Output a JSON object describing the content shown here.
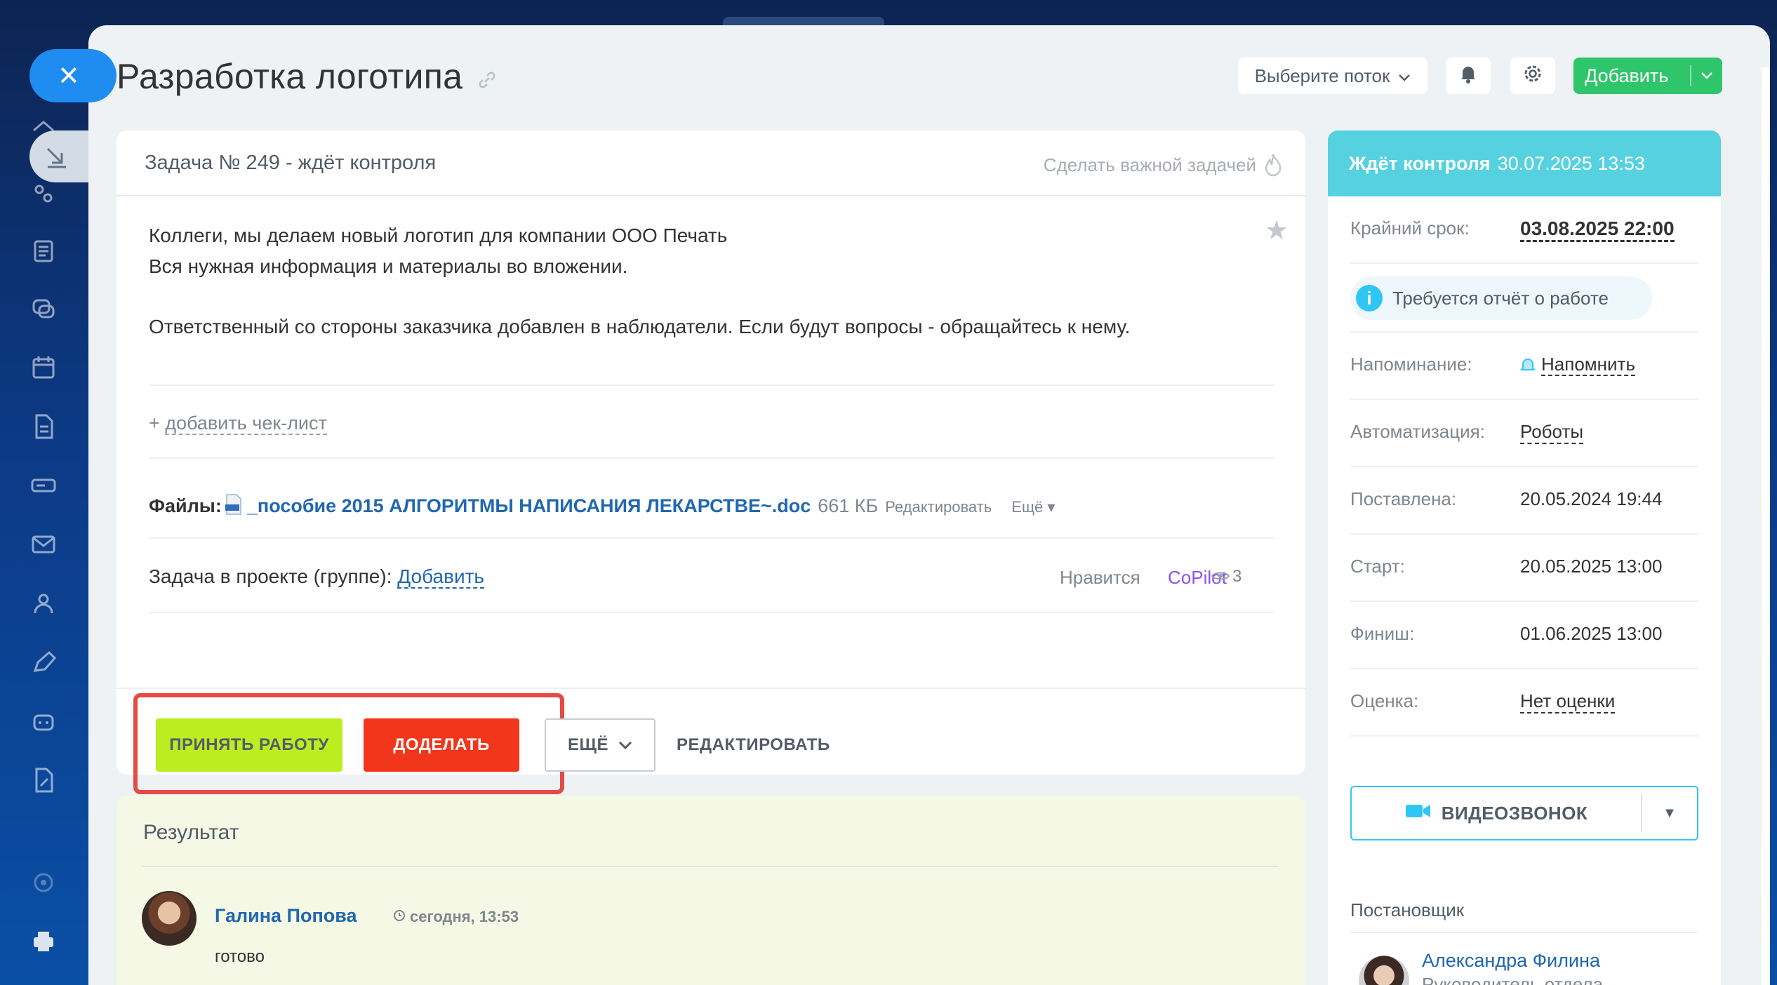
{
  "title": "Разработка логотипа",
  "header": {
    "stream_select": "Выберите поток",
    "add_label": "Добавить"
  },
  "task": {
    "heading": "Задача № 249 - ждёт контроля",
    "make_important": "Сделать важной задачей",
    "description": [
      "Коллеги, мы делаем новый логотип для компании ООО Печать",
      "Вся нужная информация и материалы во вложении.",
      "Ответственный со стороны заказчика добавлен в наблюдатели. Если будут вопросы - обращайтесь к нему."
    ],
    "checklist_plus": "+",
    "checklist_link": "добавить чек-лист",
    "files_label": "Файлы:",
    "file_name": "_пособие 2015 АЛГОРИТМЫ НАПИСАНИЯ ЛЕКАРСТВЕ~.doc",
    "file_size": "661 КБ",
    "file_edit": "Редактировать",
    "file_more": "Ещё",
    "project_label": "Задача в проекте (группе):",
    "project_add": "Добавить",
    "like": "Нравится",
    "copilot": "CoPilot",
    "views": "3"
  },
  "actions": {
    "accept": "ПРИНЯТЬ РАБОТУ",
    "redo": "ДОДЕЛАТЬ",
    "more": "ЕЩЁ",
    "edit": "РЕДАКТИРОВАТЬ"
  },
  "result": {
    "title": "Результат",
    "author": "Галина Попова",
    "time": "сегодня, 13:53",
    "text": "готово"
  },
  "sidebar": {
    "status_label": "Ждёт контроля",
    "status_date": "30.07.2025 13:53",
    "deadline_label": "Крайний срок:",
    "deadline_value": "03.08.2025 22:00",
    "report_required": "Требуется отчёт о работе",
    "reminder_label": "Напоминание:",
    "reminder_value": "Напомнить",
    "automation_label": "Автоматизация:",
    "automation_value": "Роботы",
    "created_label": "Поставлена:",
    "created_value": "20.05.2024 19:44",
    "start_label": "Старт:",
    "start_value": "20.05.2025 13:00",
    "finish_label": "Финиш:",
    "finish_value": "01.06.2025 13:00",
    "rating_label": "Оценка:",
    "rating_value": "Нет оценки",
    "video_call": "ВИДЕОЗВОНОК",
    "creator_label": "Постановщик",
    "creator_name": "Александра Филина",
    "creator_role": "Руководитель отдела маркетинга"
  },
  "colors": {
    "accept_button": "#bbed21",
    "redo_button": "#f1361b",
    "status_bar": "#56d1e0",
    "add_button": "#2fc66b",
    "highlight": "#e44b45"
  }
}
